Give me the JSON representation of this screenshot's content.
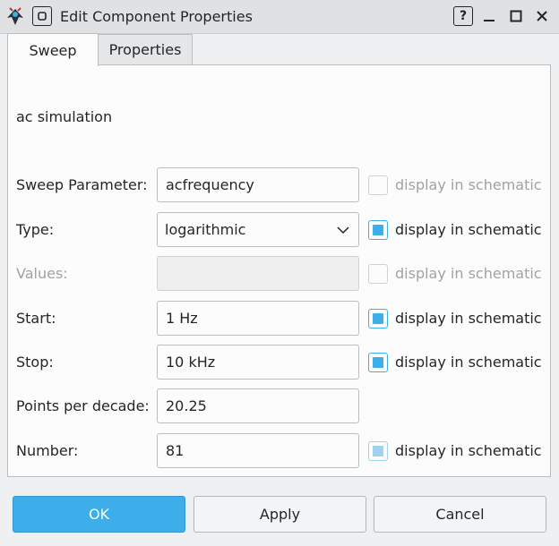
{
  "window": {
    "title": "Edit Component Properties",
    "help_glyph": "?",
    "minimize_glyph": "_"
  },
  "tabs": [
    {
      "label": "Sweep",
      "active": true
    },
    {
      "label": "Properties",
      "active": false
    }
  ],
  "panel": {
    "heading": "ac simulation",
    "rows": [
      {
        "label": "Sweep Parameter:",
        "value": "acfrequency",
        "display_label": "display in schematic",
        "checked": false,
        "enabled": true
      },
      {
        "label": "Type:",
        "value": "logarithmic",
        "display_label": "display in schematic",
        "checked": true,
        "enabled": true
      },
      {
        "label": "Values:",
        "value": "",
        "display_label": "display in schematic",
        "checked": false,
        "enabled": false
      },
      {
        "label": "Start:",
        "value": "1 Hz",
        "display_label": "display in schematic",
        "checked": true,
        "enabled": true
      },
      {
        "label": "Stop:",
        "value": "10 kHz",
        "display_label": "display in schematic",
        "checked": true,
        "enabled": true
      },
      {
        "label": "Points per decade:",
        "value": "20.25"
      },
      {
        "label": "Number:",
        "value": "81",
        "display_label": "display in schematic",
        "checked": true,
        "enabled": false
      }
    ]
  },
  "buttons": {
    "ok": "OK",
    "apply": "Apply",
    "cancel": "Cancel"
  },
  "colors": {
    "accent": "#3daee9",
    "window_bg": "#eff0f1",
    "panel_bg": "#fcfcfc"
  }
}
